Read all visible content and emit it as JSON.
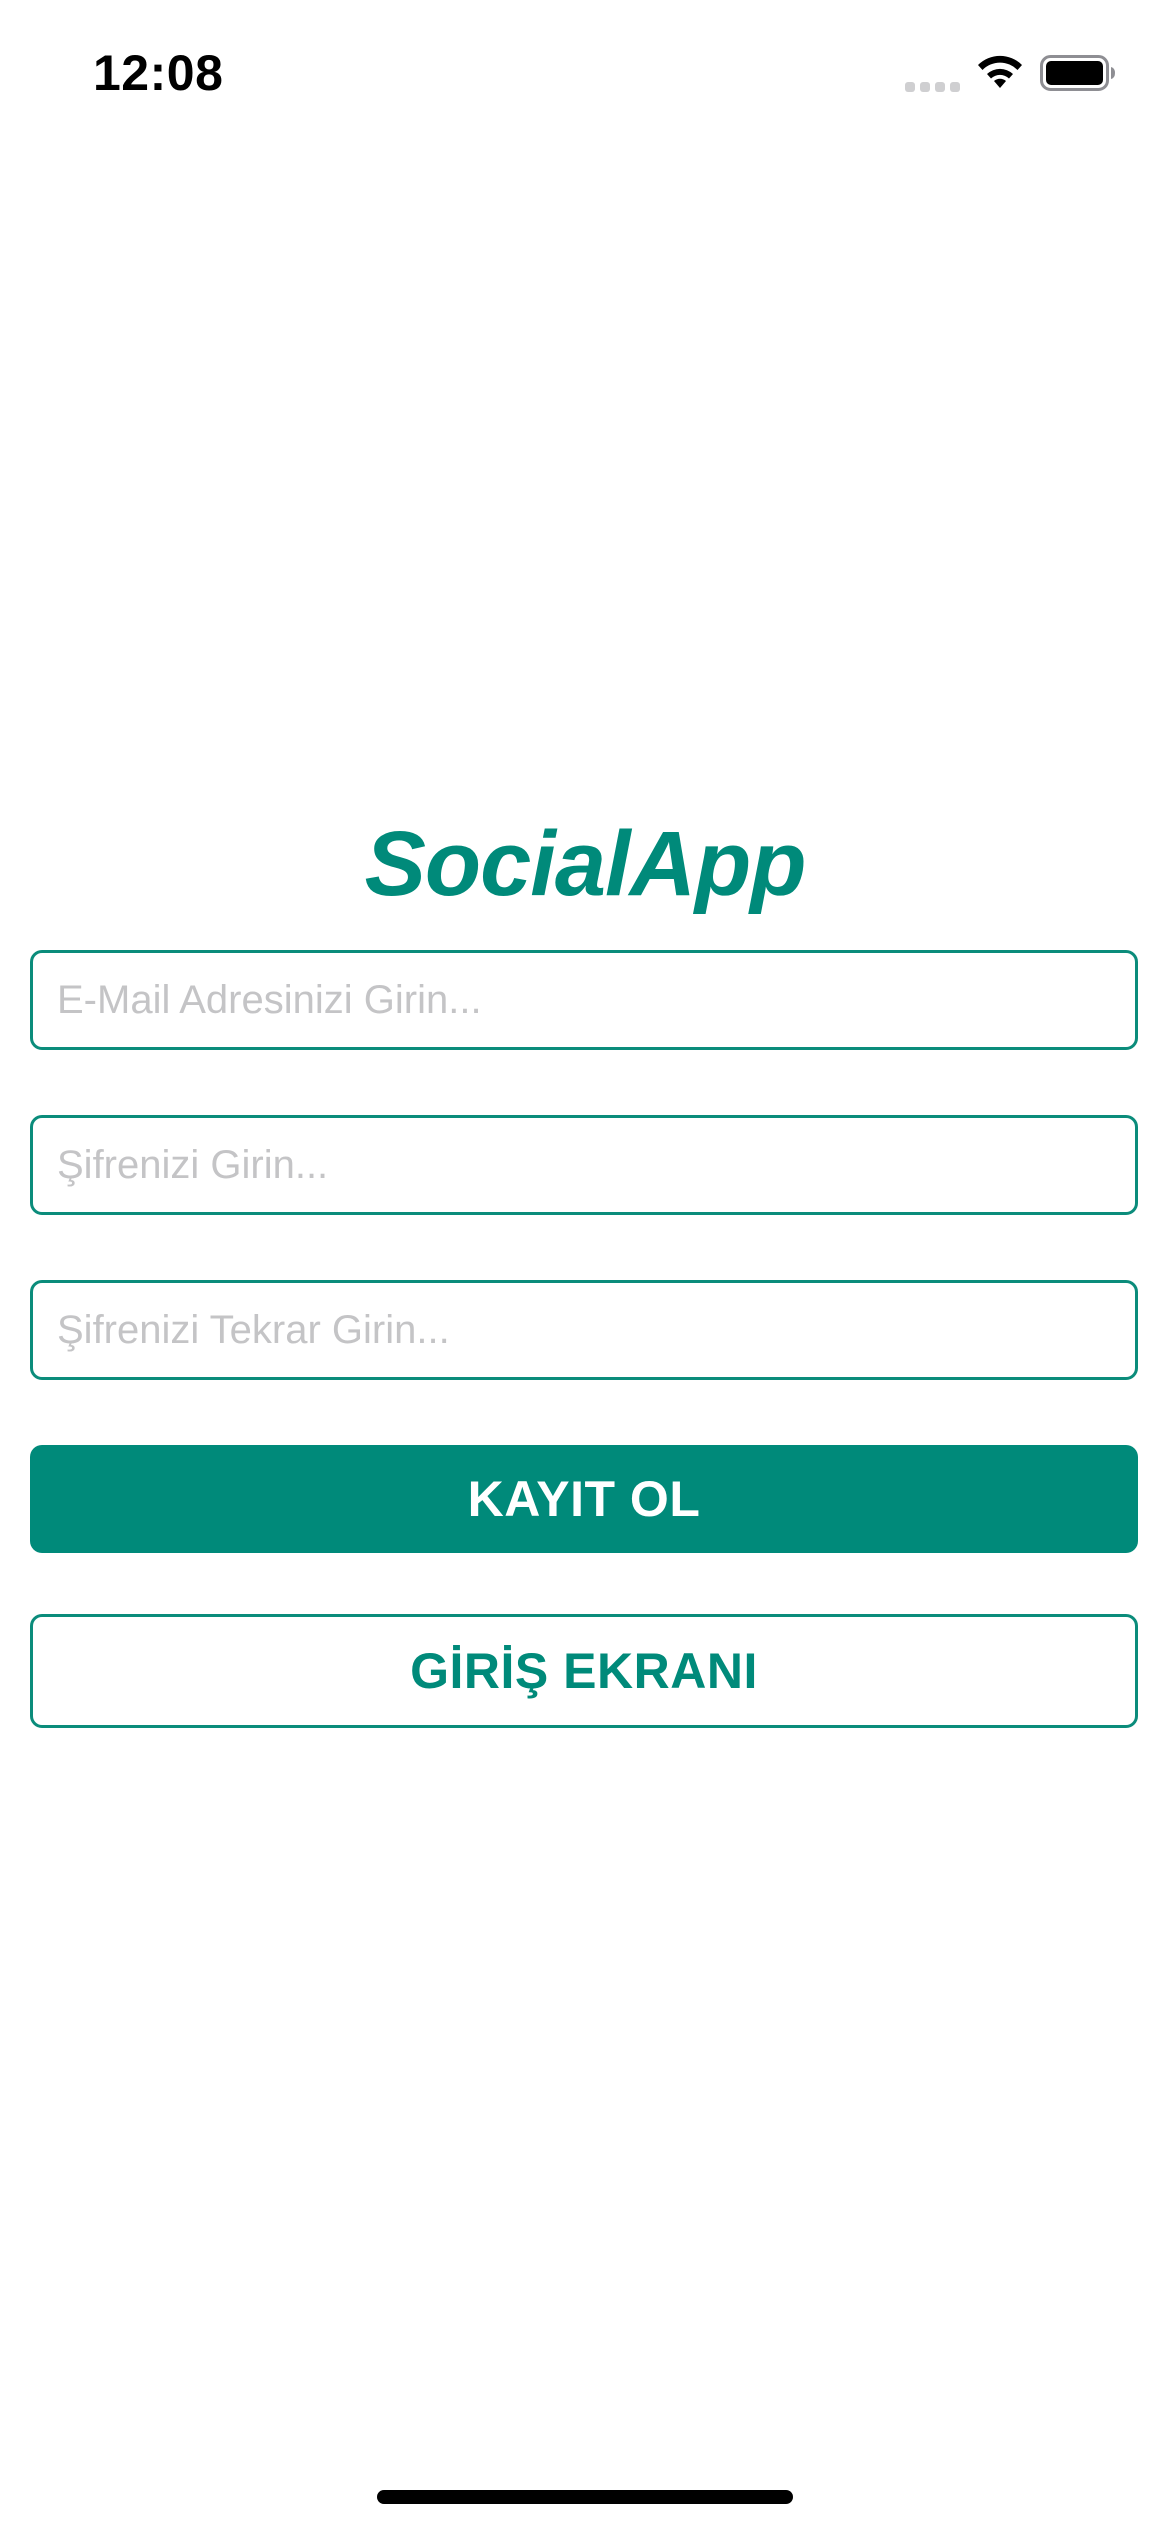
{
  "status_bar": {
    "time": "12:08",
    "icons": [
      "cellular-signal-icon",
      "wifi-icon",
      "battery-icon"
    ]
  },
  "app": {
    "title": "SocialApp",
    "accent_color": "#008a7a"
  },
  "form": {
    "email": {
      "placeholder": "E-Mail Adresinizi Girin...",
      "value": ""
    },
    "password": {
      "placeholder": "Şifrenizi Girin...",
      "value": ""
    },
    "password_repeat": {
      "placeholder": "Şifrenizi Tekrar Girin...",
      "value": ""
    },
    "register_label": "KAYIT OL",
    "login_screen_label": "GİRİŞ EKRANI"
  }
}
